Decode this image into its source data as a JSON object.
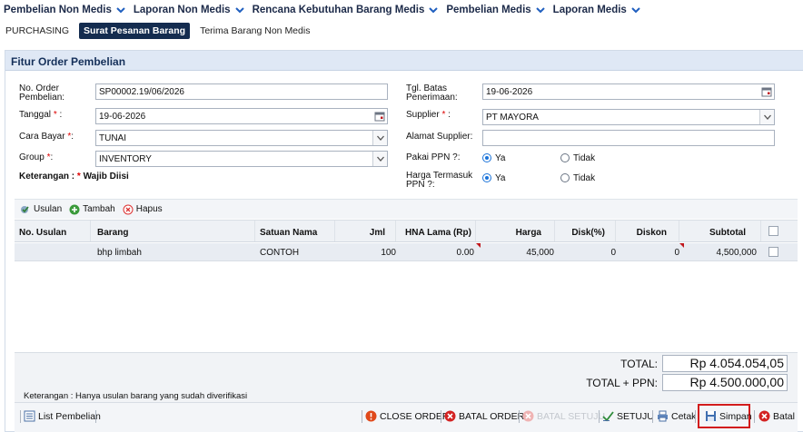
{
  "menu": [
    {
      "label": "Pembelian Non Medis"
    },
    {
      "label": "Laporan Non Medis"
    },
    {
      "label": "Rencana Kebutuhan Barang Medis"
    },
    {
      "label": "Pembelian Medis"
    },
    {
      "label": "Laporan Medis"
    }
  ],
  "tabs": [
    {
      "label": "PURCHASING"
    },
    {
      "label": "Surat Pesanan Barang"
    },
    {
      "label": "Terima Barang Non Medis"
    }
  ],
  "panel": {
    "title": "Fitur Order Pembelian"
  },
  "form": {
    "no_order_label": "No. Order Pembelian:",
    "no_order_value": "SP00002.19/06/2026",
    "tanggal_label": "Tanggal",
    "tanggal_value": "19-06-2026",
    "cara_bayar_label": "Cara Bayar",
    "cara_bayar_value": "TUNAI",
    "group_label": "Group",
    "group_value": "INVENTORY",
    "keterangan_prefix": "Keterangan : ",
    "keterangan_req": "*",
    "keterangan_text": " Wajib Diisi",
    "tgl_batas_label": "Tgl. Batas Penerimaan:",
    "tgl_batas_value": "19-06-2026",
    "supplier_label": "Supplier",
    "supplier_value": "PT MAYORA",
    "alamat_label": "Alamat Supplier:",
    "alamat_value": "",
    "pakai_ppn_label": "Pakai PPN ?:",
    "harga_ppn_label": "Harga Termasuk PPN ?:",
    "ya": "Ya",
    "tidak": "Tidak",
    "req_mark": "*",
    "colon": ":"
  },
  "grid_toolbar": {
    "usulan": "Usulan",
    "tambah": "Tambah",
    "hapus": "Hapus"
  },
  "columns": [
    "No. Usulan",
    "Barang",
    "Satuan Nama",
    "Jml",
    "HNA Lama (Rp)",
    "Harga",
    "Disk(%)",
    "Diskon",
    "Subtotal"
  ],
  "rows": [
    {
      "no_usulan": "",
      "barang": "bhp limbah",
      "satuan": "CONTOH",
      "jml": "100",
      "hna_lama": "0.00",
      "harga": "45,000",
      "disk": "0",
      "diskon": "0",
      "subtotal": "4,500,000"
    }
  ],
  "totals": {
    "total_label": "TOTAL:",
    "total_value": "Rp 4.054.054,05",
    "total_ppn_label": "TOTAL + PPN:",
    "total_ppn_value": "Rp 4.500.000,00",
    "note": "Keterangan : Hanya usulan barang yang sudah diverifikasi"
  },
  "bottom": {
    "list_pembelian": "List Pembelian",
    "close_order": "CLOSE ORDER",
    "batal_order": "BATAL ORDER",
    "batal_setuju": "BATAL SETUJU",
    "setuju": "SETUJU",
    "cetak": "Cetak",
    "simpan": "Simpan",
    "batal": "Batal"
  },
  "colors": {
    "menu_text": "#1c2a49",
    "tab_active": "#142c4f",
    "panel_header": "#dfe8f5",
    "accent_blue": "#1a73d9",
    "danger_red": "#d21c1c"
  }
}
